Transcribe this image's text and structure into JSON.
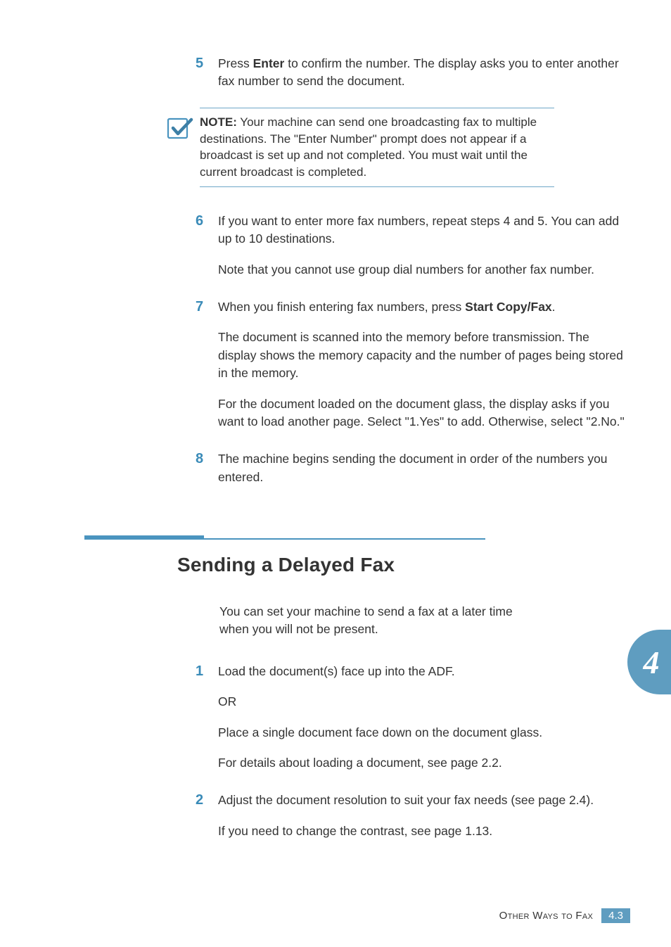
{
  "steps_a": [
    {
      "num": "5",
      "paras": [
        "Press <b>Enter</b> to confirm the number. The display asks you to enter another fax number to send the document."
      ]
    }
  ],
  "note": {
    "label": "NOTE:",
    "text": " Your machine can send one broadcasting fax to multiple destinations. The \"Enter Number\" prompt does not appear if a broadcast is set up and not completed. You must wait until the current broadcast is completed."
  },
  "steps_b": [
    {
      "num": "6",
      "paras": [
        "If you want to enter more fax numbers, repeat steps 4 and 5. You can add up to 10 destinations.",
        "Note that you cannot use group dial numbers for another fax number."
      ]
    },
    {
      "num": "7",
      "paras": [
        "When you finish entering fax numbers, press <b>Start Copy/Fax</b>.",
        "The document is scanned into the memory before transmission. The display shows the memory capacity and the number of pages being stored in the memory.",
        "For the document loaded on the document glass, the display asks if you want to load another page. Select \"1.Yes\" to add. Otherwise, select \"2.No.\""
      ]
    },
    {
      "num": "8",
      "paras": [
        "The machine begins sending the document in order of the numbers you entered."
      ]
    }
  ],
  "section": {
    "heading": "Sending a Delayed Fax",
    "intro": "You can set your machine to send a fax at a later time when you will not be present."
  },
  "steps_c": [
    {
      "num": "1",
      "paras": [
        "Load the document(s) face up into the ADF.",
        "OR",
        "Place a single document face down on the document glass.",
        "For details about loading a document, see page 2.2."
      ]
    },
    {
      "num": "2",
      "paras": [
        "Adjust the document resolution to suit your fax needs (see page 2.4).",
        "If you need to change the contrast, see page 1.13."
      ]
    }
  ],
  "chapter_tab": "4",
  "footer": {
    "label": "Other Ways to Fax",
    "page": "4.3"
  }
}
